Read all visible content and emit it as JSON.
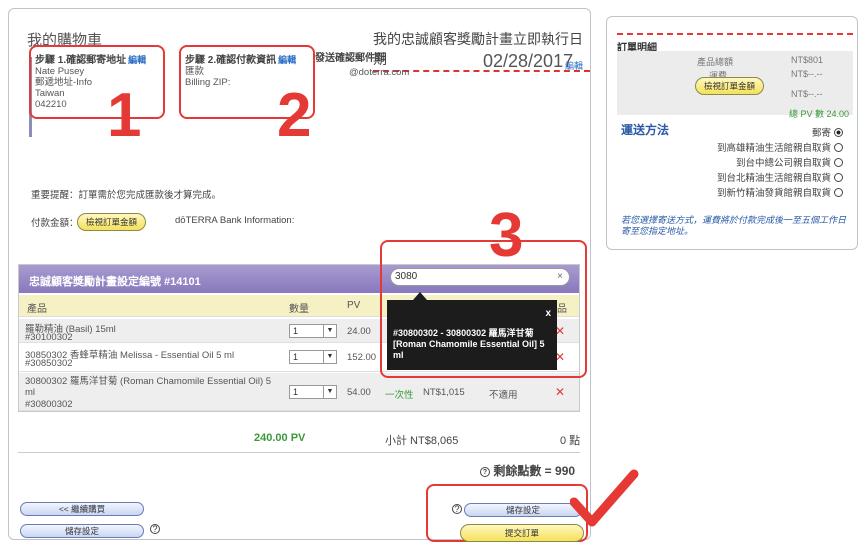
{
  "header": {
    "title": "我的購物車",
    "promo_title": "我的忠誠顧客獎勵計畫立即執行日期",
    "date": "02/28/2017",
    "date_edit": "編輯"
  },
  "step1": {
    "title": "步驟 1.確認郵寄地址",
    "edit": "編輯",
    "lines": [
      "Nate Pusey",
      "郵遞地址-Info",
      "Taiwan",
      "042210"
    ]
  },
  "step2": {
    "title": "步驟 2.確認付款資訊",
    "edit": "編輯",
    "lines": [
      "匯款",
      "Billing ZIP:"
    ],
    "email_label": "發送確認郵件到",
    "email_value": "@doterra.com"
  },
  "annotations": {
    "n1": "1",
    "n2": "2",
    "n3": "3"
  },
  "payment": {
    "notice": "重要提醒：訂單需於您完成匯款後才算完成。",
    "amount_label": "付款金額：",
    "amount_button": "檢視訂單金額",
    "bank_info": "dōTERRA Bank Information:"
  },
  "lrp_table": {
    "header": "忠誠顧客獎勵計畫設定編號 #14101",
    "search_value": "3080",
    "search_clear": "×",
    "col_product": "產品",
    "col_qty": "數量",
    "col_pv": "PV",
    "col_free": "免費品",
    "rows": [
      {
        "name": "羅勒精油 (Basil) 15ml",
        "code": "#30100302",
        "qty": "1",
        "pv": "24.00",
        "once": "",
        "price": "",
        "free": "",
        "del": "✕"
      },
      {
        "name": "30850302 香蜂草精油 Melissa - Essential Oil 5 ml",
        "code": "#30850302",
        "qty": "1",
        "pv": "152.00",
        "once": "",
        "price": "",
        "free": "",
        "del": "✕"
      },
      {
        "name": "30800302 羅馬洋甘菊 (Roman Chamomile Essential Oil) 5 ml",
        "code": "#30800302",
        "qty": "1",
        "pv": "54.00",
        "once": "一次性",
        "price": "NT$1,015",
        "free": "不適用",
        "del": "✕"
      }
    ],
    "tooltip_close": "x",
    "tooltip_text": "#30800302 - 30800302 羅馬洋甘菊 [Roman Chamomile Essential Oil] 5 ml"
  },
  "totals": {
    "pv": "240.00 PV",
    "subtotal": "小計 NT$8,065",
    "points": "0 點",
    "remaining": "剩餘點數 = 990"
  },
  "buttons": {
    "continue_shopping": "<< 繼續購買",
    "save_draft": "儲存設定",
    "settings": "儲存設定",
    "checkout": "提交訂單",
    "help1": "?",
    "help2": "?"
  },
  "side": {
    "title": "訂單明細",
    "rows": [
      {
        "label": "產品總額",
        "value": "NT$801"
      },
      {
        "label": "運費",
        "value": "NT$--.--"
      },
      {
        "label": "",
        "value": "NT$--.--"
      }
    ],
    "view_button": "檢視訂單金額",
    "pv_total": "總 PV 數 24.00",
    "ship_title": "運送方法",
    "options": [
      {
        "label": "郵寄",
        "selected": true
      },
      {
        "label": "到高雄精油生活館親自取貨",
        "selected": false
      },
      {
        "label": "到台中總公司親自取貨",
        "selected": false
      },
      {
        "label": "到台北精油生活館親自取貨",
        "selected": false
      },
      {
        "label": "到新竹精油發貨館親自取貨",
        "selected": false
      }
    ],
    "note": "若您選擇寄送方式，運費將於付款完成後一至五個工作日寄至您指定地址。"
  }
}
